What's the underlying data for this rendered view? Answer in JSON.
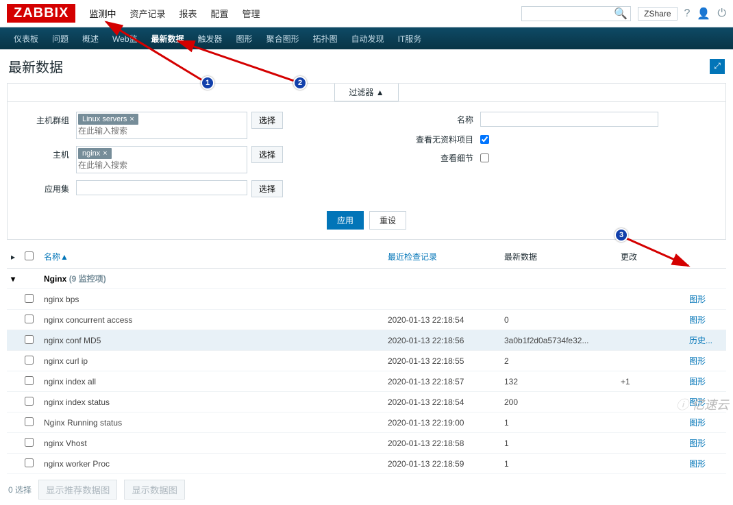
{
  "logo": "ZABBIX",
  "topmenu": [
    "监测中",
    "资产记录",
    "报表",
    "配置",
    "管理"
  ],
  "topmenu_active": 0,
  "top_right": {
    "search_placeholder": "",
    "share": "Share",
    "share_prefix": "Z"
  },
  "nav": [
    "仪表板",
    "问题",
    "概述",
    "Web监",
    "最新数据",
    "触发器",
    "图形",
    "聚合图形",
    "拓扑图",
    "自动发现",
    "IT服务"
  ],
  "nav_active": 4,
  "page_title": "最新数据",
  "filter": {
    "toggle": "过滤器  ▲",
    "labels": {
      "hostgroup": "主机群组",
      "host": "主机",
      "app": "应用集",
      "name": "名称",
      "show_empty": "查看无资料项目",
      "show_detail": "查看细节"
    },
    "hostgroup_tag": "Linux servers",
    "host_tag": "nginx",
    "ms_placeholder": "在此输入搜索",
    "select_btn": "选择",
    "show_empty_checked": true,
    "show_detail_checked": false,
    "apply": "应用",
    "reset": "重设"
  },
  "columns": {
    "name": "名称",
    "last_check": "最近检查记录",
    "last_data": "最新数据",
    "change": "更改"
  },
  "sort_indicator": "▲",
  "group_row": {
    "name": "Nginx",
    "count_label": "(9 监控项)"
  },
  "rows": [
    {
      "name": "nginx bps",
      "time": "",
      "data": "",
      "change": "",
      "link": "图形"
    },
    {
      "name": "nginx concurrent access",
      "time": "2020-01-13 22:18:54",
      "data": "0",
      "change": "",
      "link": "图形"
    },
    {
      "name": "nginx conf MD5",
      "time": "2020-01-13 22:18:56",
      "data": "3a0b1f2d0a5734fe32...",
      "change": "",
      "link": "历史...",
      "hl": true
    },
    {
      "name": "nginx curl ip",
      "time": "2020-01-13 22:18:55",
      "data": "2",
      "change": "",
      "link": "图形"
    },
    {
      "name": "nginx index all",
      "time": "2020-01-13 22:18:57",
      "data": "132",
      "change": "+1",
      "link": "图形"
    },
    {
      "name": "nginx index status",
      "time": "2020-01-13 22:18:54",
      "data": "200",
      "change": "",
      "link": "图形"
    },
    {
      "name": "Nginx Running status",
      "time": "2020-01-13 22:19:00",
      "data": "1",
      "change": "",
      "link": "图形"
    },
    {
      "name": "nginx Vhost",
      "time": "2020-01-13 22:18:58",
      "data": "1",
      "change": "",
      "link": "图形"
    },
    {
      "name": "nginx worker Proc",
      "time": "2020-01-13 22:18:59",
      "data": "1",
      "change": "",
      "link": "图形"
    }
  ],
  "footer": {
    "selected": "0 选择",
    "btn1": "显示推荐数据图",
    "btn2": "显示数据图"
  },
  "watermark": "亿速云",
  "annotations": {
    "n1": "1",
    "n2": "2",
    "n3": "3"
  }
}
